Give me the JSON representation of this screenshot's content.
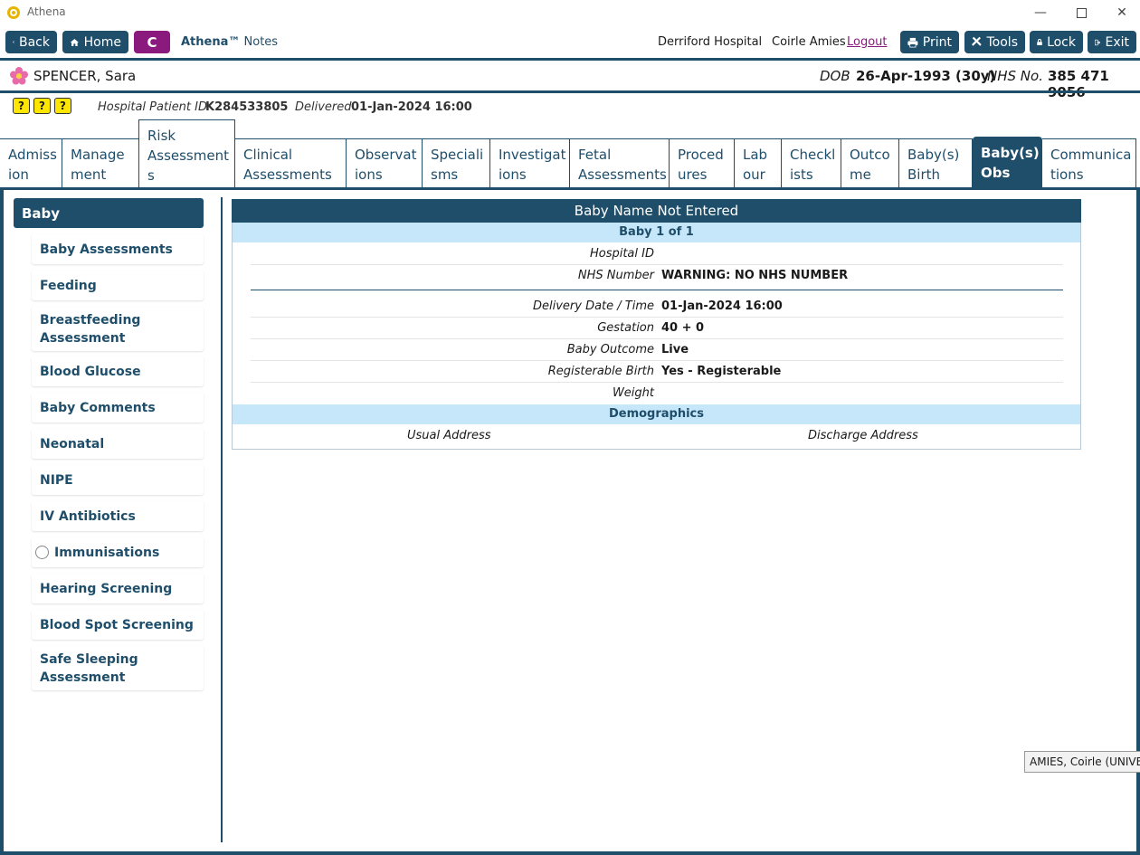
{
  "window": {
    "title": "Athena"
  },
  "toolbar": {
    "back_label": "Back",
    "home_label": "Home",
    "context_letter": "C",
    "app_name_bold": "Athena™",
    "app_name_rest": "Notes",
    "hospital": "Derriford Hospital",
    "user": "Coirle Amies",
    "logout_label": "Logout",
    "print_label": "Print",
    "tools_label": "Tools",
    "lock_label": "Lock",
    "exit_label": "Exit"
  },
  "patient": {
    "name": "SPENCER, Sara",
    "dob_label": "DOB",
    "dob_value": "26-Apr-1993 (30y)",
    "nhs_label": "NHS No.",
    "nhs_value": "385 471 9056",
    "hospital_id_label": "Hospital Patient ID",
    "hospital_id_value": "K284533805",
    "delivered_label": "Delivered",
    "delivered_value": "01-Jan-2024 16:00",
    "alerts": [
      "?",
      "?",
      "?"
    ]
  },
  "tabs": [
    {
      "label": "Admiss ion"
    },
    {
      "label": "Manage ment"
    },
    {
      "label": "Risk Assessment s"
    },
    {
      "label": "Clinical Assessments"
    },
    {
      "label": "Observat ions"
    },
    {
      "label": "Speciali sms"
    },
    {
      "label": "Investigat ions"
    },
    {
      "label": "Fetal Assessments"
    },
    {
      "label": "Proced ures"
    },
    {
      "label": "Lab our"
    },
    {
      "label": "Checkl ists"
    },
    {
      "label": "Outco me"
    },
    {
      "label": "Baby(s) Birth"
    },
    {
      "label": "Baby(s) Obs"
    },
    {
      "label": "Communica tions"
    }
  ],
  "nav": {
    "header": "Baby",
    "items": [
      {
        "label": "Baby Assessments"
      },
      {
        "label": "Feeding"
      },
      {
        "label": "Breastfeeding Assessment"
      },
      {
        "label": "Blood Glucose"
      },
      {
        "label": "Baby Comments"
      },
      {
        "label": "Neonatal"
      },
      {
        "label": "NIPE"
      },
      {
        "label": "IV Antibiotics"
      },
      {
        "label": "Immunisations"
      },
      {
        "label": "Hearing Screening"
      },
      {
        "label": "Blood Spot Screening"
      },
      {
        "label": "Safe Sleeping Assessment"
      }
    ]
  },
  "baby_card": {
    "title": "Baby Name Not Entered",
    "subtitle": "Baby 1 of  1",
    "rows": [
      {
        "label": "Hospital ID",
        "value": ""
      },
      {
        "label": "NHS Number",
        "value": "WARNING: NO NHS NUMBER"
      },
      {
        "label": "Delivery Date / Time",
        "value": "01-Jan-2024 16:00"
      },
      {
        "label": "Gestation",
        "value": "40 + 0"
      },
      {
        "label": "Baby Outcome",
        "value": "Live"
      },
      {
        "label": "Registerable Birth",
        "value": "Yes - Registerable"
      },
      {
        "label": "Weight",
        "value": ""
      }
    ],
    "demographics_label": "Demographics",
    "usual_address_label": "Usual Address",
    "discharge_address_label": "Discharge Address"
  },
  "tooltip": "AMIES, Coirle (UNIVERS",
  "colors": {
    "primary": "#1f4e6b",
    "accent": "#8a1a7e",
    "band": "#c6e6fa",
    "panel_bg": "#e8f4fc"
  }
}
